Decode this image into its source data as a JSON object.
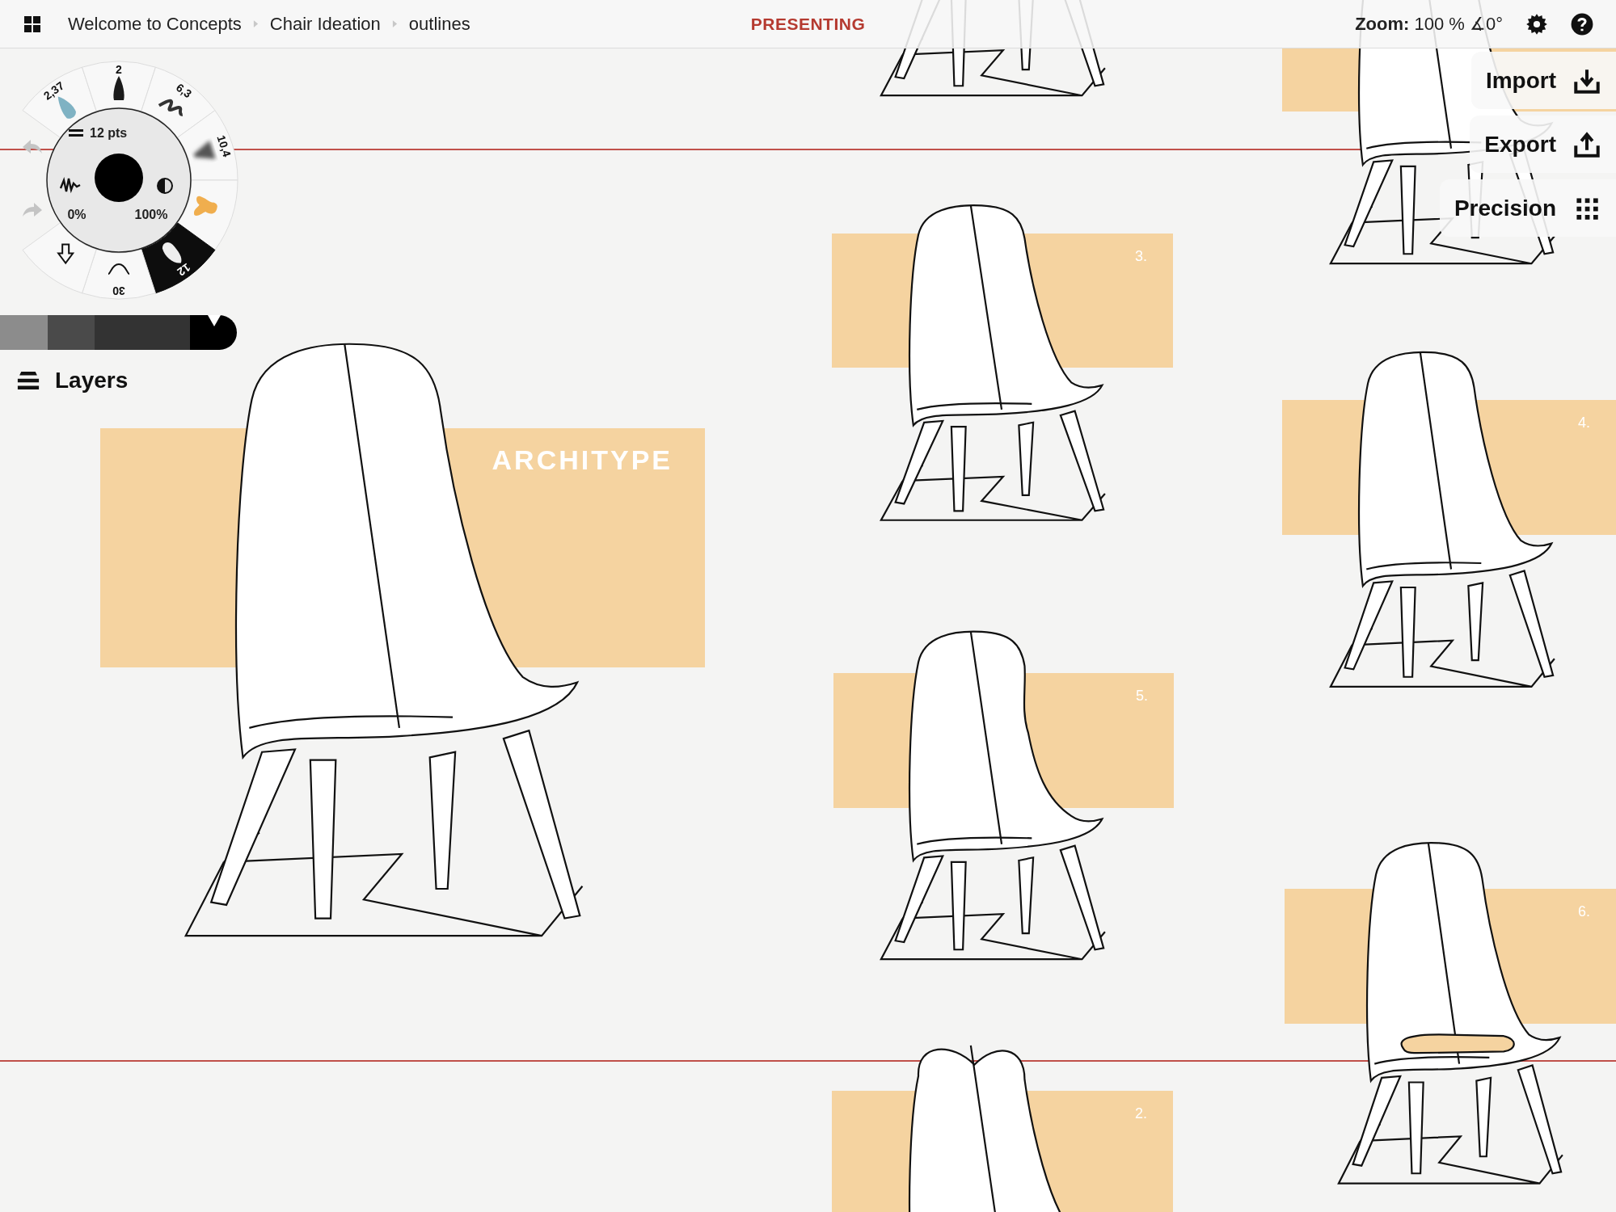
{
  "top_bar": {
    "breadcrumbs": [
      {
        "label": "Welcome to Concepts"
      },
      {
        "label": "Chair Ideation"
      },
      {
        "label": "outlines"
      }
    ],
    "mode": "PRESENTING",
    "zoom_label": "Zoom:",
    "zoom_value": "100 % ∡0°"
  },
  "tool_wheel": {
    "size": "12 pts",
    "smoothing": "0%",
    "opacity": "100%",
    "color": "#000000",
    "brushes": [
      {
        "kind": "nib",
        "label": "2,37",
        "color": "#7fb2c3",
        "selected": false
      },
      {
        "kind": "pen",
        "label": "2",
        "color": "#1a1a1a",
        "selected": false
      },
      {
        "kind": "marker",
        "label": "6,3",
        "color": "#333333",
        "selected": false
      },
      {
        "kind": "airbrush",
        "label": "10,4",
        "color": "#555555",
        "selected": false
      },
      {
        "kind": "fill",
        "color": "#f0ae4e",
        "selected": false
      },
      {
        "kind": "watercolor",
        "label": "12",
        "color": "#eeeeee",
        "selected": true
      },
      {
        "kind": "smooth",
        "label": "30",
        "selected": false
      },
      {
        "kind": "move",
        "selected": false
      }
    ],
    "history": [
      {
        "kind": "undo",
        "disabled": true
      },
      {
        "kind": "redo",
        "disabled": true
      }
    ]
  },
  "palette": [
    {
      "color": "#8c8c8c",
      "selected": false
    },
    {
      "color": "#4a4a4a",
      "selected": false
    },
    {
      "color": "#333333",
      "selected": false
    },
    {
      "color": "#000000",
      "selected": true
    }
  ],
  "layers_button": {
    "label": "Layers"
  },
  "side_menu": [
    {
      "label": "Import",
      "kind": "import"
    },
    {
      "label": "Export",
      "kind": "export"
    },
    {
      "label": "Precision",
      "kind": "precision"
    }
  ],
  "canvas": {
    "cards": [
      {
        "kind": "titled",
        "label": "ARCHITYPE"
      },
      {
        "kind": "numbered",
        "label": "3."
      },
      {
        "kind": "numbered",
        "label": "5."
      },
      {
        "kind": "numbered",
        "label": "2."
      },
      {
        "kind": "blank"
      },
      {
        "kind": "numbered",
        "label": "4."
      },
      {
        "kind": "numbered",
        "label": "6."
      }
    ]
  }
}
